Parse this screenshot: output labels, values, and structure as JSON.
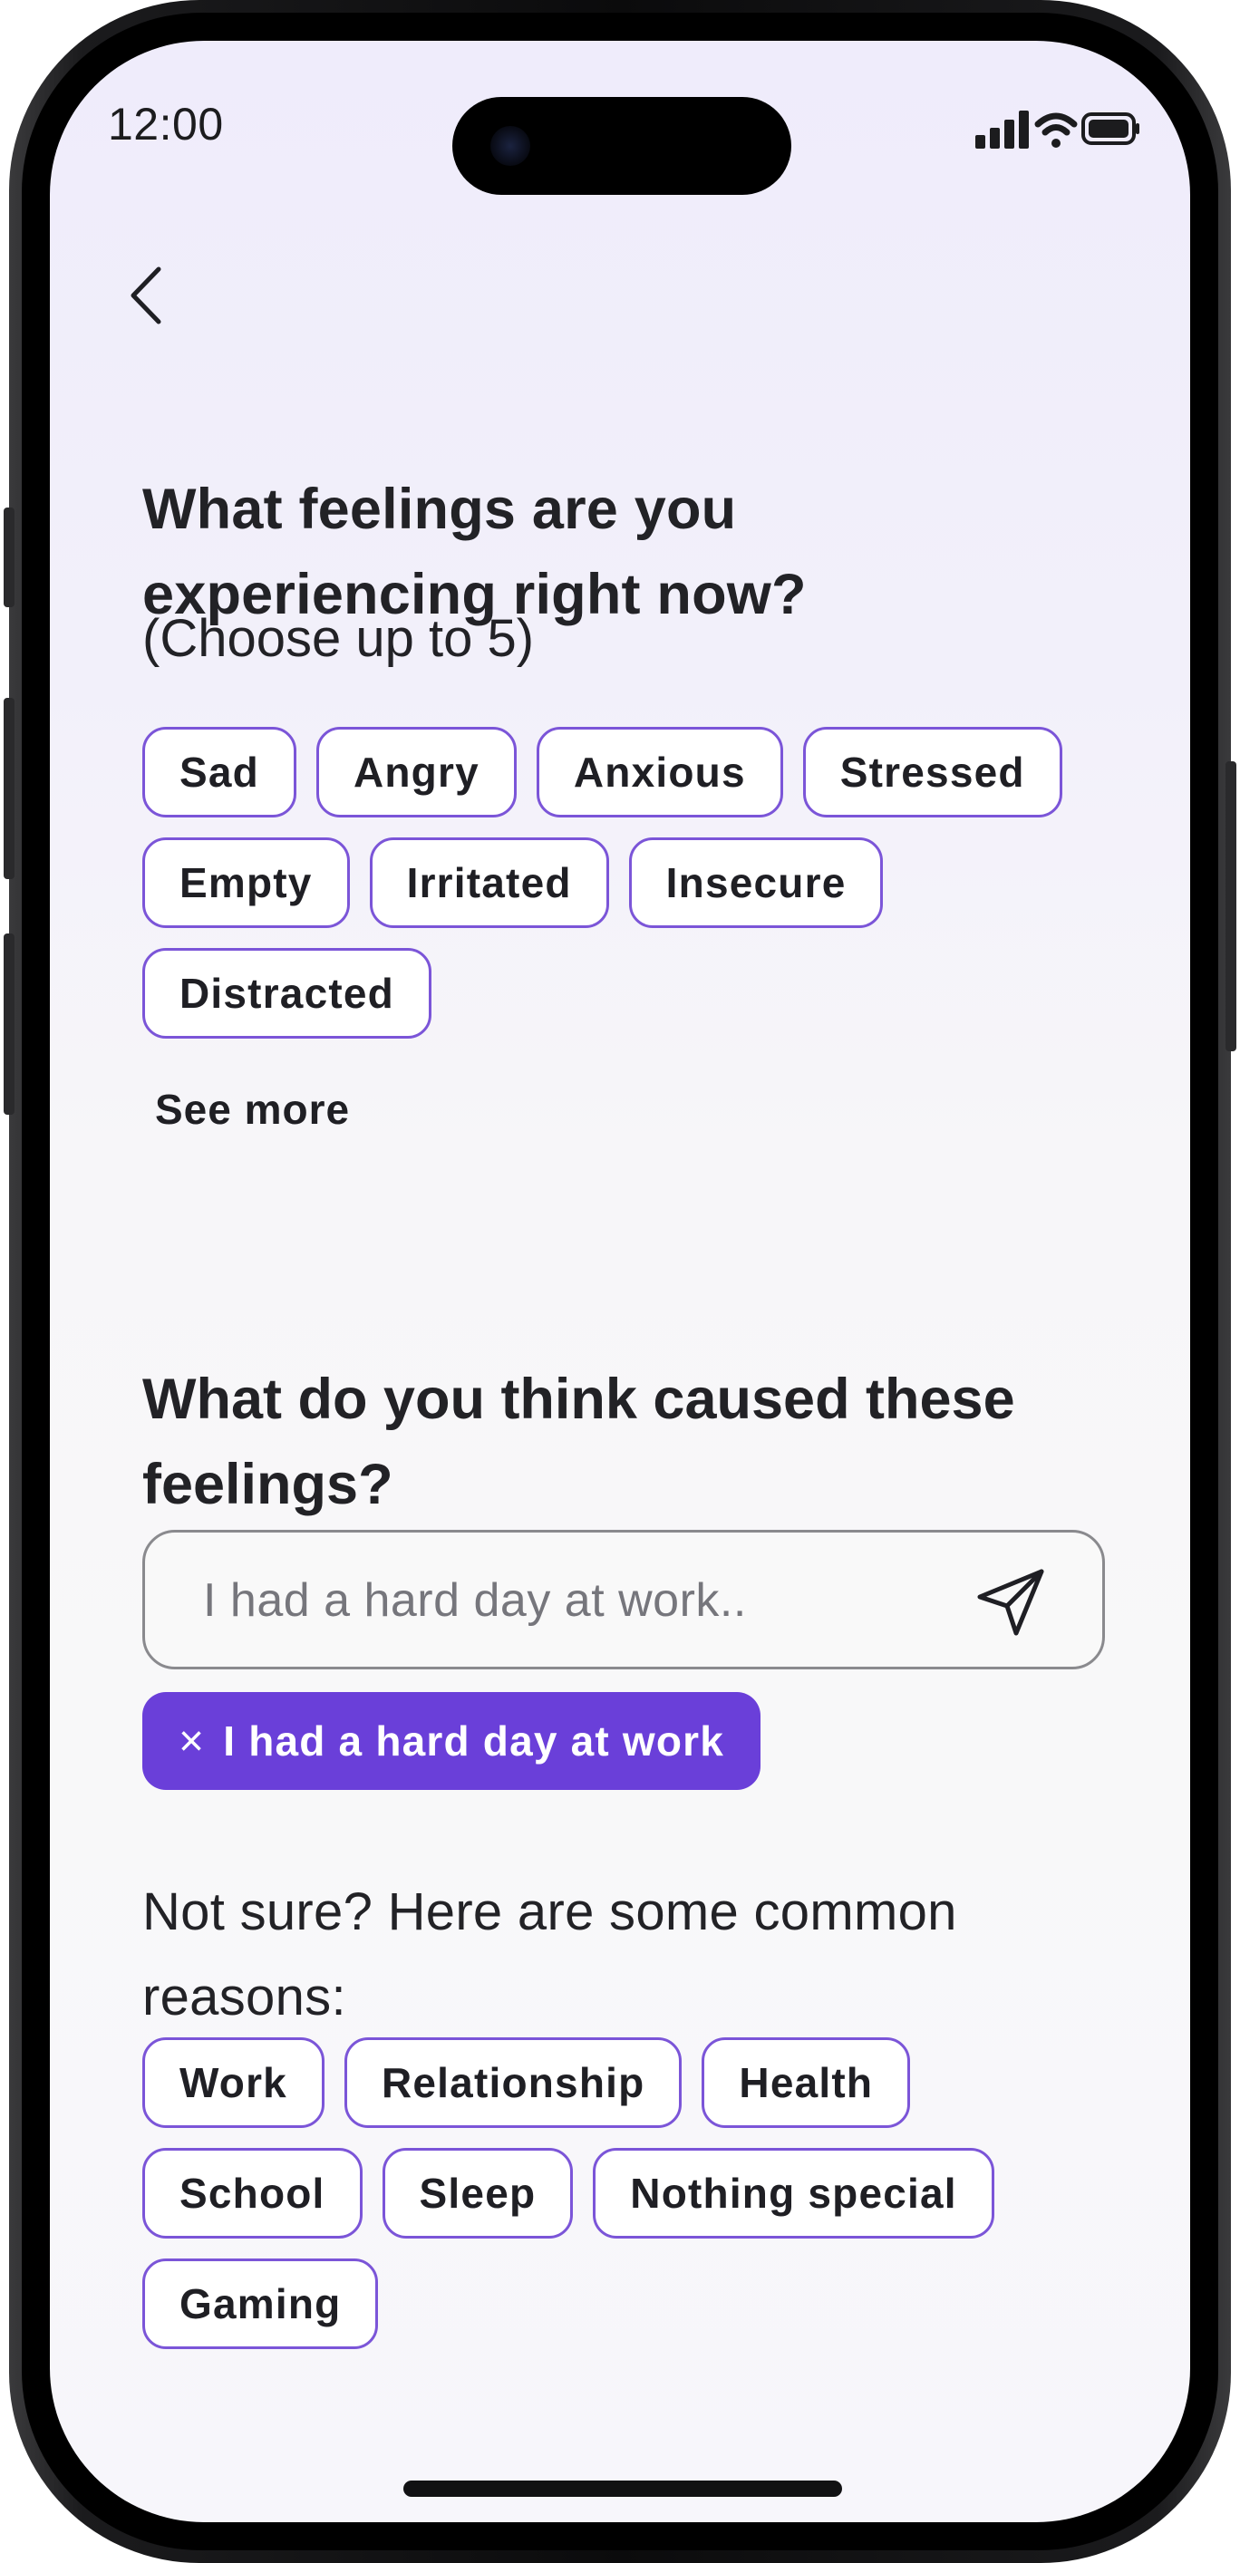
{
  "status_bar": {
    "time": "12:00",
    "icons": [
      "cellular-signal-icon",
      "wifi-icon",
      "battery-icon"
    ]
  },
  "navigation": {
    "back_icon": "chevron-left-icon"
  },
  "feelings_section": {
    "title": "What feelings are you experiencing right now?",
    "subtitle": "(Choose up to 5)",
    "chips": [
      "Sad",
      "Angry",
      "Anxious",
      "Stressed",
      "Empty",
      "Irritated",
      "Insecure",
      "Distracted"
    ],
    "see_more": "See more"
  },
  "cause_section": {
    "title": "What do you think caused these feelings?",
    "input": {
      "placeholder": "I had a hard day at work..",
      "value": ""
    },
    "send_icon": "send-icon",
    "selected": {
      "remove_symbol": "×",
      "label": "I had a hard day at work"
    },
    "common_reasons_title": "Not sure? Here are some common reasons:",
    "reasons": [
      "Work",
      "Relationship",
      "Health",
      "School",
      "Sleep",
      "Nothing special",
      "Gaming"
    ]
  },
  "colors": {
    "accent": "#6a3fd9",
    "chip_border": "#7b55d8",
    "text": "#1f1f24",
    "background_top": "#efecfb",
    "background_bottom": "#f8f8f9"
  }
}
